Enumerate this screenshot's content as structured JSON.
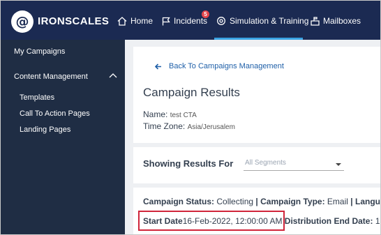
{
  "brand": {
    "name": "IRONSCALES",
    "logo_glyph": "@"
  },
  "nav": {
    "home": "Home",
    "incidents": "Incidents",
    "incidents_badge": "5",
    "simulation": "Simulation & Training",
    "mailboxes": "Mailboxes"
  },
  "sidebar": {
    "my_campaigns": "My Campaigns",
    "content_management": "Content Management",
    "items": [
      "Templates",
      "Call To Action Pages",
      "Landing Pages"
    ]
  },
  "header": {
    "back_link": "Back To Campaigns Management",
    "title": "Campaign Results",
    "name_label": "Name:",
    "name_value": "test CTA",
    "timezone_label": "Time Zone:",
    "timezone_value": "Asia/Jerusalem"
  },
  "filter": {
    "label": "Showing Results For",
    "placeholder": "All Segments"
  },
  "status": {
    "status_label": "Campaign Status:",
    "status_value": "Collecting",
    "separator": "|",
    "type_label": "Campaign Type:",
    "type_value": "Email",
    "language_label": "Langu",
    "start_label": "Start Date",
    "start_value": "16-Feb-2022, 12:00:00 AM",
    "end_label": "Distribution End Date:",
    "end_value": "1"
  },
  "colors": {
    "nav_bg": "#1b2a52",
    "sidebar_bg": "#1f2d44",
    "accent": "#3aa3e3",
    "link": "#1e5fa8",
    "highlight": "#d0253a"
  }
}
